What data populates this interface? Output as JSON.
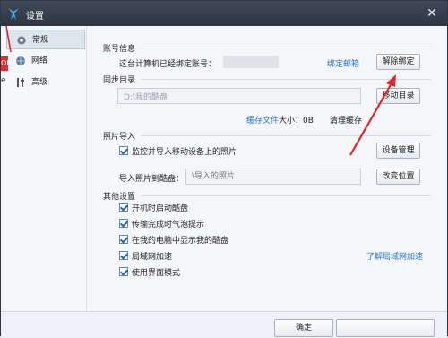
{
  "window": {
    "title": "设置"
  },
  "sidebar": {
    "items": [
      {
        "label": "常规",
        "icon": "gear-icon"
      },
      {
        "label": "网络",
        "icon": "globe-icon"
      },
      {
        "label": "高级",
        "icon": "tools-icon"
      }
    ]
  },
  "account": {
    "section_title": "账号信息",
    "bound_text": "这台计算机已经绑定账号：",
    "bind_email_link": "绑定邮箱",
    "unbind_button": "解除绑定"
  },
  "sync": {
    "section_title": "同步目录",
    "path_value": "D:\\我的酷盘",
    "move_button": "移动目录",
    "cache_label": "缓存文件",
    "cache_size": "大小：0B",
    "clear_cache": "清理缓存"
  },
  "photo": {
    "section_title": "照片导入",
    "monitor_label": "监控并导入移动设备上的照片",
    "device_button": "设备管理",
    "import_to_label": "导入照片到酷盘：",
    "import_path_placeholder": "\\导入的照片",
    "change_location_button": "改变位置"
  },
  "other": {
    "section_title": "其他设置",
    "options": [
      {
        "label": "开机时启动酷盘",
        "checked": true
      },
      {
        "label": "传输完成时气泡提示",
        "checked": true
      },
      {
        "label": "在我的电脑中显示我的酷盘",
        "checked": true
      },
      {
        "label": "局域网加速",
        "checked": true
      },
      {
        "label": "使用界面模式",
        "checked": true
      }
    ],
    "lan_link": "了解局域网加速"
  },
  "footer": {
    "ok_button": "确定"
  },
  "edge": {
    "badge_text": "OF"
  },
  "colors": {
    "accent_link": "#2a74c6",
    "annotation_red": "#e0262a",
    "titlebar": "#343d4b"
  }
}
